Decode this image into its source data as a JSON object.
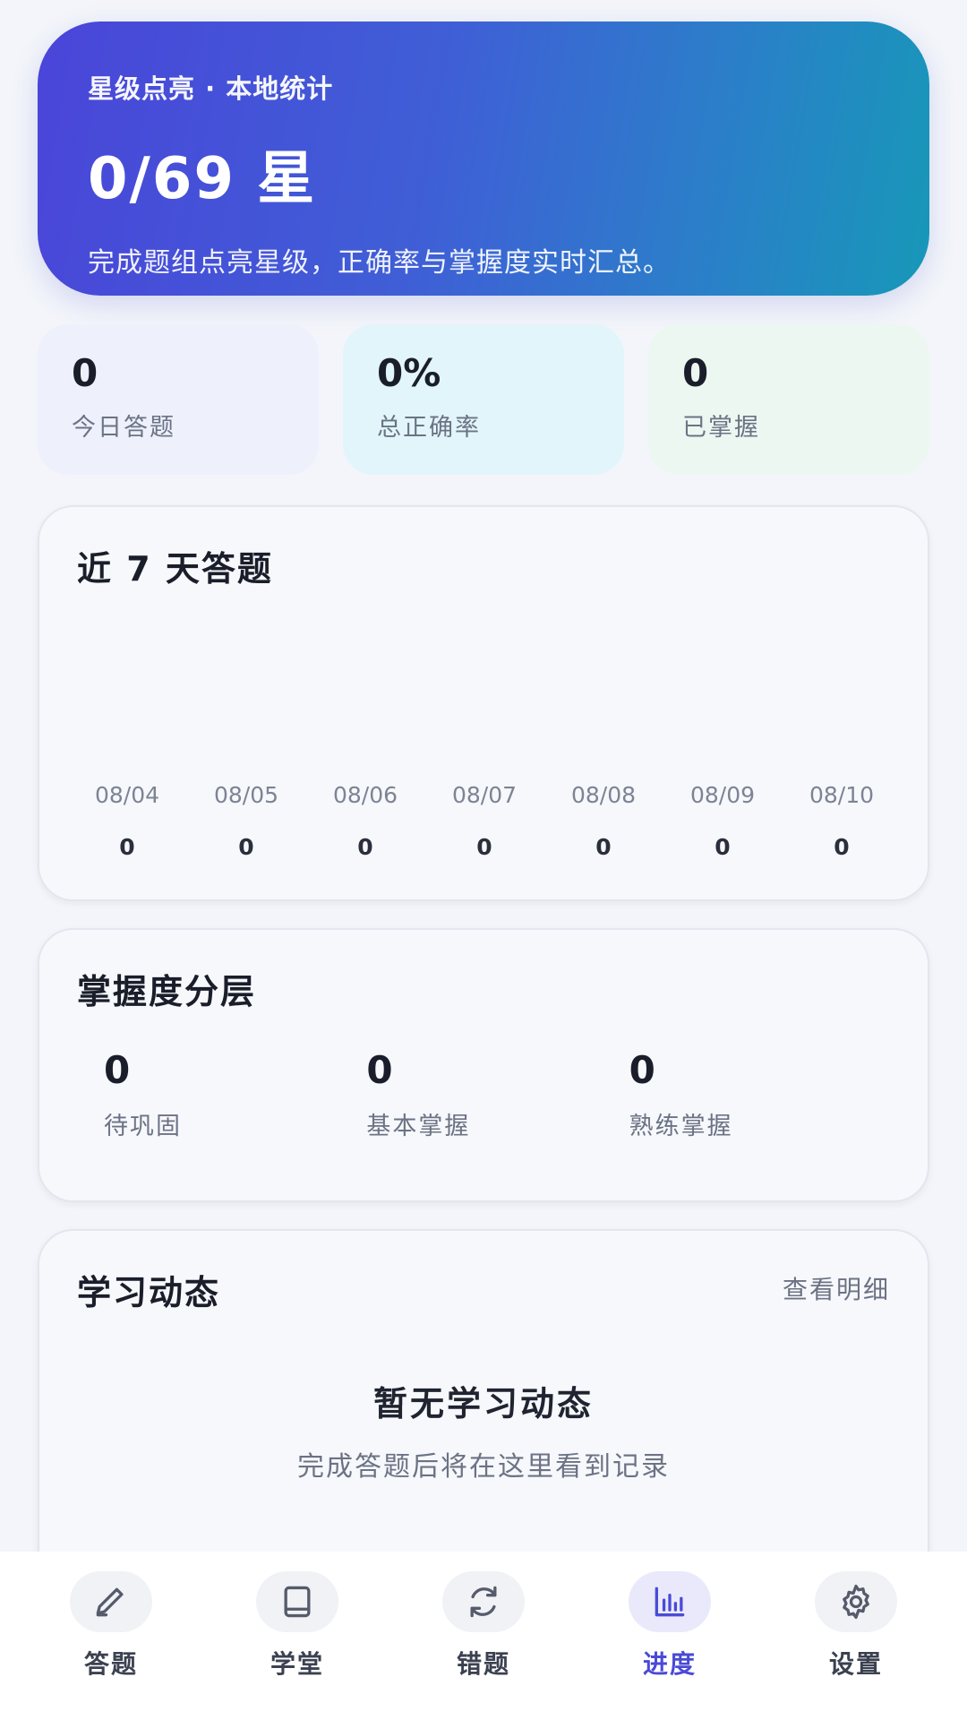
{
  "hero": {
    "subtitle": "星级点亮 · 本地统计",
    "title": "0/69 星",
    "description": "完成题组点亮星级，正确率与掌握度实时汇总。"
  },
  "stats": [
    {
      "value": "0",
      "label": "今日答题"
    },
    {
      "value": "0%",
      "label": "总正确率"
    },
    {
      "value": "0",
      "label": "已掌握"
    }
  ],
  "chart_data": {
    "type": "bar",
    "title": "近 7 天答题",
    "categories": [
      "08/04",
      "08/05",
      "08/06",
      "08/07",
      "08/08",
      "08/09",
      "08/10"
    ],
    "values": [
      0,
      0,
      0,
      0,
      0,
      0,
      0
    ]
  },
  "mastery": {
    "title": "掌握度分层",
    "items": [
      {
        "value": "0",
        "label": "待巩固"
      },
      {
        "value": "0",
        "label": "基本掌握"
      },
      {
        "value": "0",
        "label": "熟练掌握"
      }
    ]
  },
  "activity": {
    "title": "学习动态",
    "link_label": "查看明细",
    "empty_title": "暂无学习动态",
    "empty_desc": "完成答题后将在这里看到记录"
  },
  "nav": {
    "items": [
      {
        "label": "答题",
        "icon": "pencil-icon"
      },
      {
        "label": "学堂",
        "icon": "book-icon"
      },
      {
        "label": "错题",
        "icon": "refresh-icon"
      },
      {
        "label": "进度",
        "icon": "bar-chart-icon",
        "active": true
      },
      {
        "label": "设置",
        "icon": "gear-icon"
      }
    ]
  },
  "colors": {
    "accent": "#4a4ad6",
    "hero_start": "#4a45d9",
    "hero_end": "#1798b8"
  }
}
